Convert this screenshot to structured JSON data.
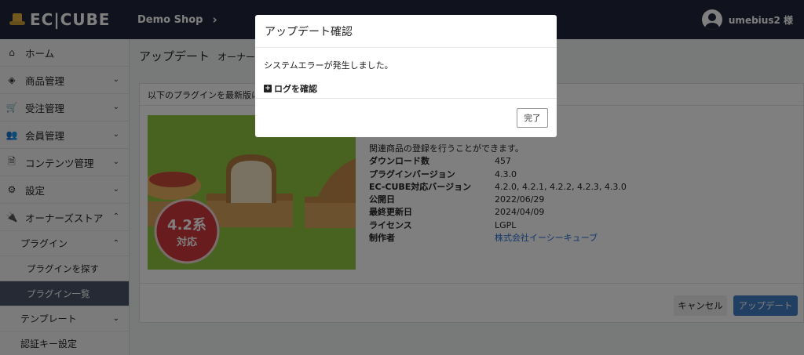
{
  "header": {
    "logo_text": "EC|CUBE",
    "shop_name": "Demo Shop",
    "shop_chevron": "›",
    "user_name": "umebius2 様"
  },
  "sidebar": {
    "items": [
      {
        "label": "ホーム",
        "icon": "home-icon",
        "glyph": "⌂"
      },
      {
        "label": "商品管理",
        "icon": "cube-icon",
        "glyph": "◈",
        "caret": "⌄"
      },
      {
        "label": "受注管理",
        "icon": "cart-icon",
        "glyph": "🛒",
        "caret": "⌄"
      },
      {
        "label": "会員管理",
        "icon": "users-icon",
        "glyph": "👥",
        "caret": "⌄"
      },
      {
        "label": "コンテンツ管理",
        "icon": "file-icon",
        "glyph": "🗎",
        "caret": "⌄"
      },
      {
        "label": "設定",
        "icon": "gear-icon",
        "glyph": "⚙",
        "caret": "⌄"
      },
      {
        "label": "オーナーズストア",
        "icon": "plug-icon",
        "glyph": "🔌",
        "caret": "⌃"
      }
    ],
    "sub_plugin": {
      "label": "プラグイン",
      "caret": "⌃"
    },
    "sub_plugin_find": "プラグインを探す",
    "sub_plugin_list": "プラグイン一覧",
    "sub_template": {
      "label": "テンプレート",
      "caret": "⌄"
    },
    "sub_auth_key": "認証キー設定"
  },
  "main": {
    "title": "アップデート",
    "subtitle": "オーナー",
    "card_header": "以下のプラグインを最新版に",
    "image_badge_line1": "4.2系",
    "image_badge_line2": "対応",
    "description": "関連商品の登録を行うことができます。",
    "details": [
      {
        "key": "ダウンロード数",
        "value": "457"
      },
      {
        "key": "プラグインバージョン",
        "value": "4.3.0"
      },
      {
        "key": "EC-CUBE対応バージョン",
        "value": "4.2.0, 4.2.1, 4.2.2, 4.2.3, 4.3.0"
      },
      {
        "key": "公開日",
        "value": "2022/06/29"
      },
      {
        "key": "最終更新日",
        "value": "2024/04/09"
      },
      {
        "key": "ライセンス",
        "value": "LGPL"
      },
      {
        "key": "制作者",
        "value": "株式会社イーシーキューブ"
      }
    ],
    "cancel_label": "キャンセル",
    "update_label": "アップデート"
  },
  "modal": {
    "title": "アップデート確認",
    "message": "システムエラーが発生しました。",
    "log_label": "ログを確認",
    "log_icon": "+",
    "done_label": "完了"
  },
  "colors": {
    "header_bg": "#20273a",
    "primary_button": "#437ec4",
    "active_nav": "#4a5568",
    "image_bg": "#8ec63f",
    "badge": "#d0393b",
    "link": "#2a6fdb"
  }
}
